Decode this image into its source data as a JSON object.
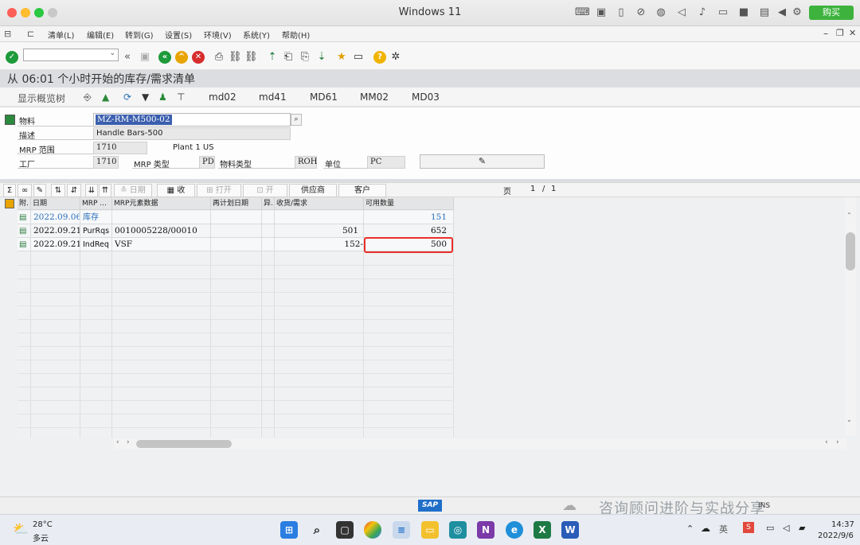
{
  "window": {
    "title": "Windows 11",
    "buy_label": "购买"
  },
  "vm_toolbar_icons": [
    "keyboard-icon",
    "cpu-icon",
    "usb-icon",
    "no-sign-icon",
    "globe-icon",
    "speaker-icon",
    "microphone-icon",
    "drive-icon",
    "camera-icon",
    "screen-icon",
    "play-icon",
    "settings-icon"
  ],
  "menu": [
    "清单(L)",
    "编辑(E)",
    "转到(G)",
    "设置(S)",
    "环境(V)",
    "系统(Y)",
    "帮助(H)"
  ],
  "page_title": "从 06:01 个小时开始的库存/需求清单",
  "app_toolbar": {
    "show_tree": "显示概览树",
    "links": [
      "md02",
      "md41",
      "MD61",
      "MM02",
      "MD03"
    ]
  },
  "header": {
    "material_label": "物料",
    "material_value": "MZ-RM-M500-02",
    "desc_label": "描述",
    "desc_value": "Handle Bars-500",
    "mrp_area_label": "MRP 范围",
    "mrp_area_value": "1710",
    "mrp_area_text": "Plant 1 US",
    "plant_label": "工厂",
    "plant_value": "1710",
    "mrp_type_label": "MRP 类型",
    "mrp_type_value": "PD",
    "mat_type_label": "物料类型",
    "mat_type_value": "ROH",
    "unit_label": "单位",
    "unit_value": "PC"
  },
  "grid_toolbar": {
    "date": "日期",
    "receive": "收",
    "open": "打开",
    "open2": "开",
    "vendor": "供应商",
    "customer": "客户",
    "page_label": "页",
    "page_current": "1",
    "page_sep": "/",
    "page_total": "1"
  },
  "table": {
    "headers": [
      "附.",
      "日期",
      "MRP ...",
      "MRP元素数据",
      "再计划日期",
      "异.",
      "收货/需求",
      "可用数量"
    ],
    "rows": [
      {
        "date": "2022.09.06",
        "mrp": "库存",
        "data": "",
        "replan": "",
        "exc": "",
        "qty": "",
        "avail": "151",
        "highlight": true
      },
      {
        "date": "2022.09.21",
        "mrp": "PurRqs",
        "data": "0010005228/00010",
        "replan": "",
        "exc": "",
        "qty": "501",
        "avail": "652",
        "highlight": false
      },
      {
        "date": "2022.09.21",
        "mrp": "IndReq",
        "data": "VSF",
        "replan": "",
        "exc": "",
        "qty": "152-",
        "avail": "500",
        "highlight": false
      }
    ]
  },
  "status_bar": {
    "sap": "SAP",
    "watermark": "咨询顾问进阶与实战分享",
    "ins": "INS"
  },
  "taskbar": {
    "temp": "28°C",
    "weather": "多云",
    "time": "14:37",
    "date": "2022/9/6",
    "ime": "英"
  }
}
